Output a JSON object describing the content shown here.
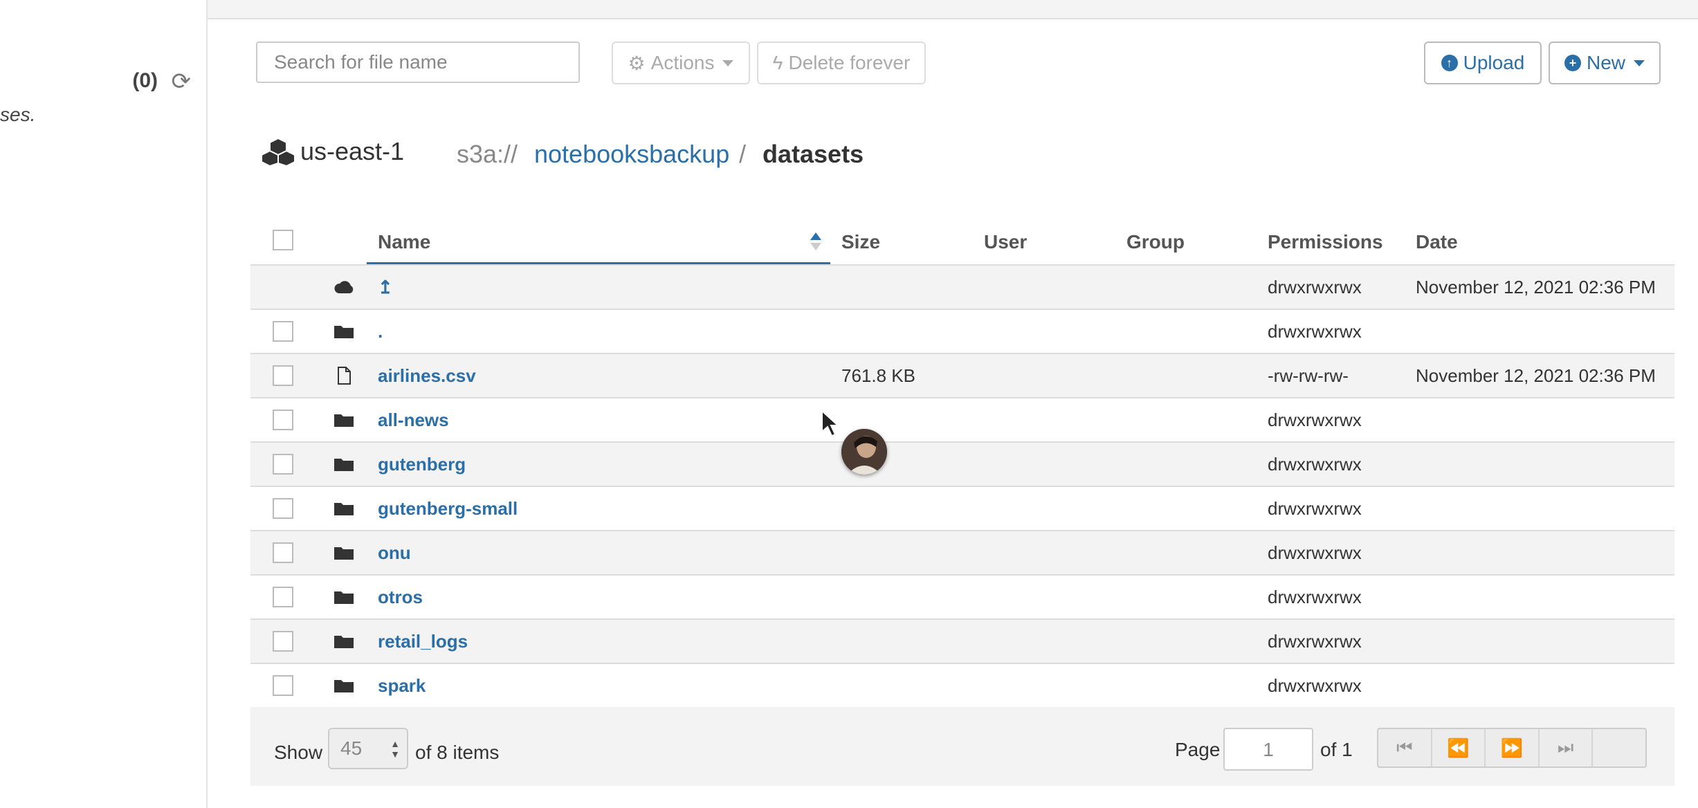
{
  "left_panel": {
    "count": "(0)",
    "snippet": "ses."
  },
  "toolbar": {
    "search_placeholder": "Search for file name",
    "actions_label": "Actions",
    "delete_label": "Delete forever",
    "upload_label": "Upload",
    "new_label": "New"
  },
  "breadcrumb": {
    "region": "us-east-1",
    "scheme": "s3a://",
    "bucket": "notebooksbackup",
    "separator": "/",
    "folder": "datasets"
  },
  "table": {
    "headers": {
      "name": "Name",
      "size": "Size",
      "user": "User",
      "group": "Group",
      "permissions": "Permissions",
      "date": "Date"
    },
    "rows": [
      {
        "icon": "cloud-icon",
        "name": "↥",
        "size": "",
        "permissions": "drwxrwxrwx",
        "date": "November 12, 2021 02:36 PM",
        "checkbox": false
      },
      {
        "icon": "folder-icon",
        "name": ".",
        "size": "",
        "permissions": "drwxrwxrwx",
        "date": "",
        "checkbox": true
      },
      {
        "icon": "file-icon",
        "name": "airlines.csv",
        "size": "761.8 KB",
        "permissions": "-rw-rw-rw-",
        "date": "November 12, 2021 02:36 PM",
        "checkbox": true
      },
      {
        "icon": "folder-icon",
        "name": "all-news",
        "size": "",
        "permissions": "drwxrwxrwx",
        "date": "",
        "checkbox": true
      },
      {
        "icon": "folder-icon",
        "name": "gutenberg",
        "size": "",
        "permissions": "drwxrwxrwx",
        "date": "",
        "checkbox": true
      },
      {
        "icon": "folder-icon",
        "name": "gutenberg-small",
        "size": "",
        "permissions": "drwxrwxrwx",
        "date": "",
        "checkbox": true
      },
      {
        "icon": "folder-icon",
        "name": "onu",
        "size": "",
        "permissions": "drwxrwxrwx",
        "date": "",
        "checkbox": true
      },
      {
        "icon": "folder-icon",
        "name": "otros",
        "size": "",
        "permissions": "drwxrwxrwx",
        "date": "",
        "checkbox": true
      },
      {
        "icon": "folder-icon",
        "name": "retail_logs",
        "size": "",
        "permissions": "drwxrwxrwx",
        "date": "",
        "checkbox": true
      },
      {
        "icon": "folder-icon",
        "name": "spark",
        "size": "",
        "permissions": "drwxrwxrwx",
        "date": "",
        "checkbox": true
      }
    ]
  },
  "footer": {
    "show_label": "Show",
    "page_size": "45",
    "items_text": "of 8 items",
    "page_label": "Page",
    "page_value": "1",
    "of_pages": "of 1"
  },
  "colors": {
    "link": "#2a6fa8",
    "stripe": "#f3f3f3"
  }
}
